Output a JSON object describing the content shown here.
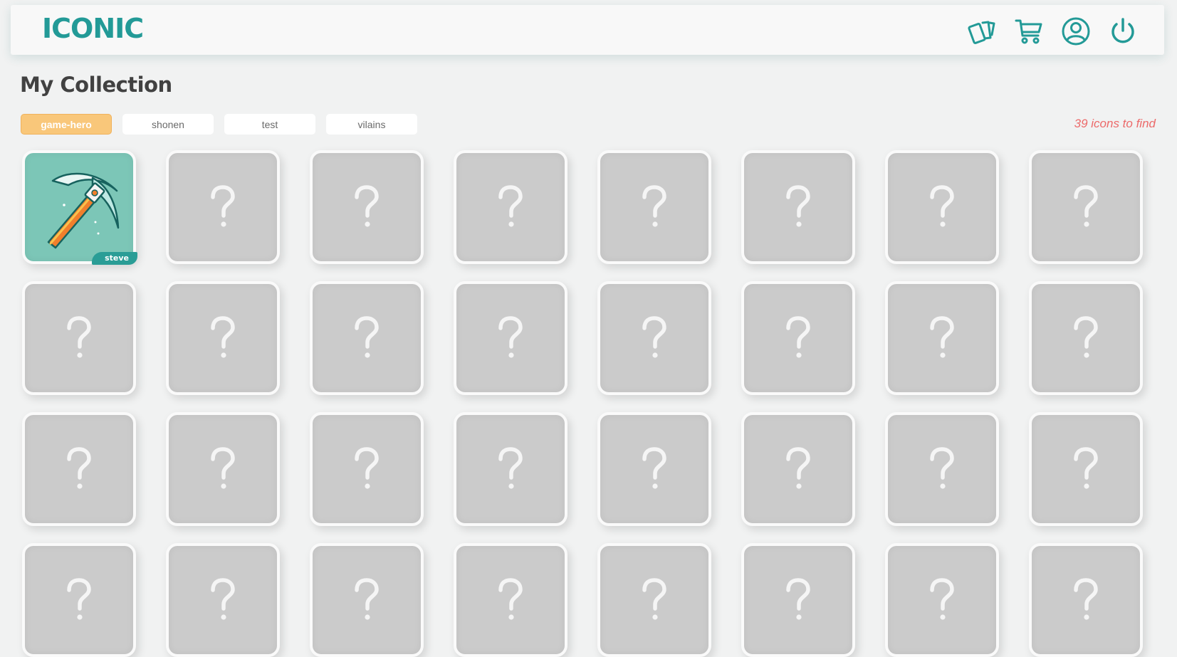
{
  "app": {
    "logo": "ICONIC"
  },
  "nav": [
    {
      "name": "cards-icon",
      "label": ""
    },
    {
      "name": "cart-icon",
      "label": ""
    },
    {
      "name": "user-icon",
      "label": ""
    },
    {
      "name": "power-icon",
      "label": ""
    }
  ],
  "page": {
    "title": "My Collection",
    "counter": "39 icons to find"
  },
  "tabs": [
    {
      "label": "game-hero",
      "active": true
    },
    {
      "label": "shonen",
      "active": false
    },
    {
      "label": "test",
      "active": false
    },
    {
      "label": "vilains",
      "active": false
    }
  ],
  "grid": {
    "found_card": {
      "tag": "steve",
      "icon": "pickaxe-icon"
    },
    "placeholder_icon": "question-mark-icon",
    "total_visible_cards": 32
  },
  "colors": {
    "accent": "#239a97",
    "active_tab": "#f9c77a",
    "counter": "#ec6a6a",
    "placeholder": "#cbcbcb",
    "found_bg": "#7cc6b7"
  }
}
